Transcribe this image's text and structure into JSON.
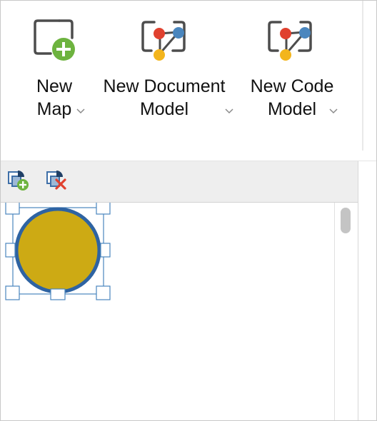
{
  "ribbon": {
    "new_map": {
      "line1": "New",
      "line2": "Map",
      "icon": "new-map-icon"
    },
    "new_document_model": {
      "line1": "New Document",
      "line2": "Model",
      "icon": "document-model-icon"
    },
    "new_code_model": {
      "line1": "New Code",
      "line2": "Model",
      "icon": "code-model-icon"
    }
  },
  "toolbar": {
    "add_icon": "add-layer-icon",
    "remove_icon": "remove-layer-icon"
  },
  "canvas": {
    "shape": "circle",
    "shape_fill": "#CDAA14",
    "shape_stroke": "#2E63A2",
    "selected": true
  },
  "colors": {
    "green": "#6DB33F",
    "red": "#E0412F",
    "blue": "#4A86BE",
    "yellow": "#F3B51C",
    "icon_gray": "#4D4D4D"
  }
}
